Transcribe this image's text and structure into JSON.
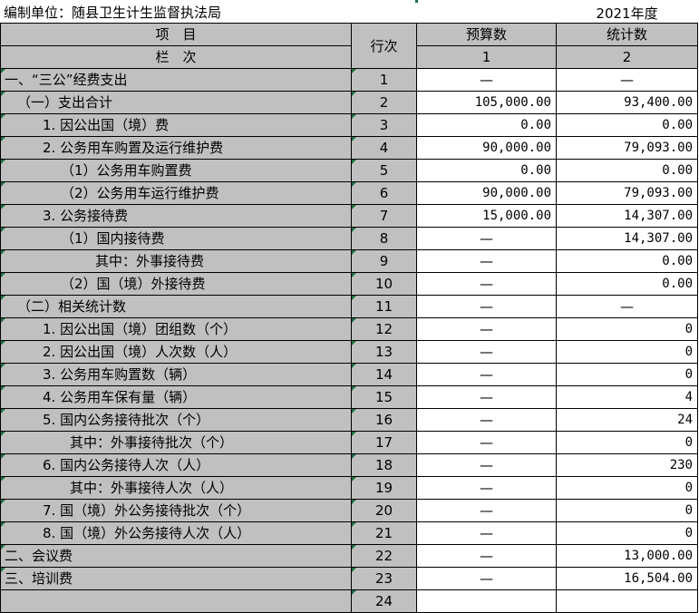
{
  "header": {
    "unit_label": "编制单位：随县卫生计生监督执法局",
    "year_label": "2021年度"
  },
  "columns": {
    "item": "项　目",
    "column": "栏　次",
    "row_no": "行次",
    "budget": "预算数",
    "stats": "统计数",
    "budget_no": "1",
    "stats_no": "2"
  },
  "rows": [
    {
      "label": "一、“三公”经费支出",
      "row": "1",
      "budget": "—",
      "stats": "—"
    },
    {
      "label": "（一）支出合计",
      "row": "2",
      "budget": "105,000.00",
      "stats": "93,400.00"
    },
    {
      "label": "1. 因公出国（境）费",
      "row": "3",
      "budget": "0.00",
      "stats": "0.00"
    },
    {
      "label": "2. 公务用车购置及运行维护费",
      "row": "4",
      "budget": "90,000.00",
      "stats": "79,093.00"
    },
    {
      "label": "（1）公务用车购置费",
      "row": "5",
      "budget": "0.00",
      "stats": "0.00"
    },
    {
      "label": "（2）公务用车运行维护费",
      "row": "6",
      "budget": "90,000.00",
      "stats": "79,093.00"
    },
    {
      "label": "3. 公务接待费",
      "row": "7",
      "budget": "15,000.00",
      "stats": "14,307.00"
    },
    {
      "label": "（1）国内接待费",
      "row": "8",
      "budget": "—",
      "stats": "14,307.00"
    },
    {
      "label": "其中：外事接待费",
      "row": "9",
      "budget": "—",
      "stats": "0.00"
    },
    {
      "label": "（2）国（境）外接待费",
      "row": "10",
      "budget": "—",
      "stats": "0.00"
    },
    {
      "label": "（二）相关统计数",
      "row": "11",
      "budget": "—",
      "stats": "—"
    },
    {
      "label": "1. 因公出国（境）团组数（个）",
      "row": "12",
      "budget": "—",
      "stats": "0"
    },
    {
      "label": "2. 因公出国（境）人次数（人）",
      "row": "13",
      "budget": "—",
      "stats": "0"
    },
    {
      "label": "3. 公务用车购置数（辆）",
      "row": "14",
      "budget": "—",
      "stats": "0"
    },
    {
      "label": "4. 公务用车保有量（辆）",
      "row": "15",
      "budget": "—",
      "stats": "4"
    },
    {
      "label": "5. 国内公务接待批次（个）",
      "row": "16",
      "budget": "—",
      "stats": "24"
    },
    {
      "label": "其中：外事接待批次（个）",
      "row": "17",
      "budget": "—",
      "stats": "0"
    },
    {
      "label": "6. 国内公务接待人次（人）",
      "row": "18",
      "budget": "—",
      "stats": "230"
    },
    {
      "label": "其中：外事接待人次（人）",
      "row": "19",
      "budget": "—",
      "stats": "0"
    },
    {
      "label": "7. 国（境）外公务接待批次（个）",
      "row": "20",
      "budget": "—",
      "stats": "0"
    },
    {
      "label": "8. 国（境）外公务接待人次（人）",
      "row": "21",
      "budget": "—",
      "stats": "0"
    },
    {
      "label": "二、会议费",
      "row": "22",
      "budget": "—",
      "stats": "13,000.00"
    },
    {
      "label": "三、培训费",
      "row": "23",
      "budget": "—",
      "stats": "16,504.00"
    },
    {
      "label": "",
      "row": "24",
      "budget": "",
      "stats": ""
    }
  ]
}
